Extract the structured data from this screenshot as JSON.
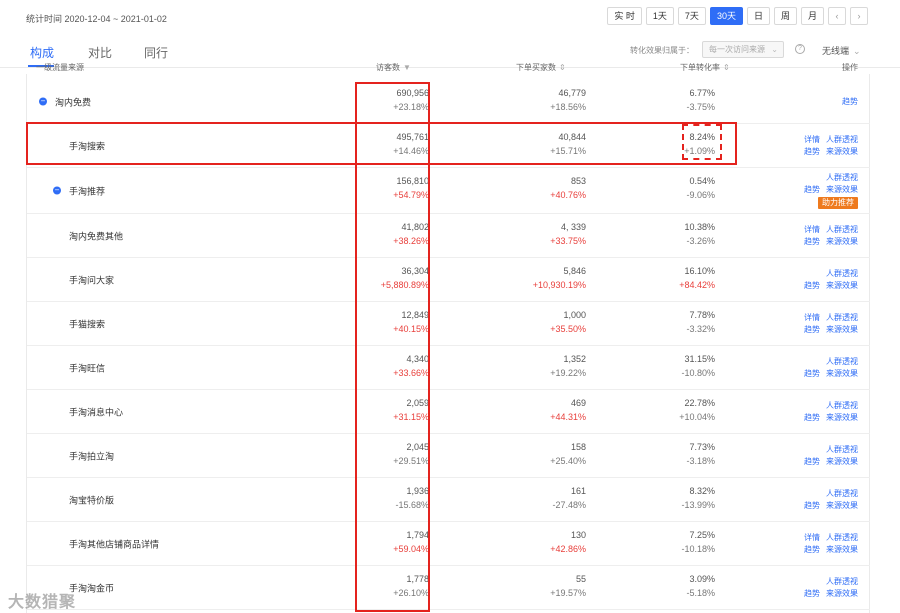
{
  "header": {
    "stat_range": "统计时间 2020-12-04 ~ 2021-01-02",
    "periods": [
      "实 时",
      "1天",
      "7天",
      "30天",
      "日",
      "周",
      "月"
    ],
    "active_period": "30天",
    "prev_arrow": "‹",
    "next_arrow": "›"
  },
  "tabs": [
    "构成",
    "对比",
    "同行"
  ],
  "active_tab": "构成",
  "attribution": {
    "label": "转化效果归属于：",
    "select_value": "每一次访问来源",
    "chevron": "⌄",
    "help": "?",
    "mode_value": "无线端",
    "mode_chevron": "⌄"
  },
  "columns": {
    "source": "一级流量来源",
    "visitors": "访客数",
    "visitors_sort": "▼",
    "buyers": "下单买家数",
    "buyers_sort": "⇕",
    "conversion": "下单转化率",
    "conversion_sort": "⇕",
    "ops": "操作"
  },
  "colors": {
    "accent": "#2f6df6",
    "increase": "#e8403c",
    "highlight": "#e4231e",
    "badge": "#ee7a1e"
  },
  "rows": [
    {
      "name": "淘内免费",
      "collapsible": true,
      "visitors": "690,956",
      "visitors_chg": "+23.18%",
      "visitors_up": false,
      "buyers": "46,779",
      "buyers_chg": "+18.56%",
      "buyers_up": false,
      "conv": "6.77%",
      "conv_chg": "-3.75%",
      "conv_up": false,
      "ops": [
        [
          "趋势"
        ]
      ]
    },
    {
      "name": "手淘搜索",
      "visitors": "495,761",
      "visitors_chg": "+14.46%",
      "visitors_up": false,
      "buyers": "40,844",
      "buyers_chg": "+15.71%",
      "buyers_up": false,
      "conv": "8.24%",
      "conv_chg": "+1.09%",
      "conv_up": false,
      "ops": [
        [
          "详情",
          "人群透视"
        ],
        [
          "趋势",
          "来源效果"
        ]
      ]
    },
    {
      "name": "手淘推荐",
      "collapsible": true,
      "visitors": "156,810",
      "visitors_chg": "+54.79%",
      "visitors_up": true,
      "buyers": "853",
      "buyers_chg": "+40.76%",
      "buyers_up": true,
      "conv": "0.54%",
      "conv_chg": "-9.06%",
      "conv_up": false,
      "ops": [
        [
          "人群透视"
        ],
        [
          "趋势",
          "来源效果"
        ]
      ],
      "badge": "助力推荐"
    },
    {
      "name": "淘内免费其他",
      "visitors": "41,802",
      "visitors_chg": "+38.26%",
      "visitors_up": true,
      "buyers": "4, 339",
      "buyers_chg": "+33.75%",
      "buyers_up": true,
      "conv": "10.38%",
      "conv_chg": "-3.26%",
      "conv_up": false,
      "ops": [
        [
          "详情",
          "人群透视"
        ],
        [
          "趋势",
          "来源效果"
        ]
      ]
    },
    {
      "name": "手淘问大家",
      "visitors": "36,304",
      "visitors_chg": "+5,880.89%",
      "visitors_up": true,
      "buyers": "5,846",
      "buyers_chg": "+10,930.19%",
      "buyers_up": true,
      "conv": "16.10%",
      "conv_chg": "+84.42%",
      "conv_up": true,
      "ops": [
        [
          "人群透视"
        ],
        [
          "趋势",
          "来源效果"
        ]
      ]
    },
    {
      "name": "手猫搜索",
      "visitors": "12,849",
      "visitors_chg": "+40.15%",
      "visitors_up": true,
      "buyers": "1,000",
      "buyers_chg": "+35.50%",
      "buyers_up": true,
      "conv": "7.78%",
      "conv_chg": "-3.32%",
      "conv_up": false,
      "ops": [
        [
          "详情",
          "人群透视"
        ],
        [
          "趋势",
          "来源效果"
        ]
      ]
    },
    {
      "name": "手淘旺信",
      "visitors": "4,340",
      "visitors_chg": "+33.66%",
      "visitors_up": true,
      "buyers": "1,352",
      "buyers_chg": "+19.22%",
      "buyers_up": false,
      "conv": "31.15%",
      "conv_chg": "-10.80%",
      "conv_up": false,
      "ops": [
        [
          "人群透视"
        ],
        [
          "趋势",
          "来源效果"
        ]
      ]
    },
    {
      "name": "手淘消息中心",
      "visitors": "2,059",
      "visitors_chg": "+31.15%",
      "visitors_up": true,
      "buyers": "469",
      "buyers_chg": "+44.31%",
      "buyers_up": true,
      "conv": "22.78%",
      "conv_chg": "+10.04%",
      "conv_up": false,
      "ops": [
        [
          "人群透视"
        ],
        [
          "趋势",
          "来源效果"
        ]
      ]
    },
    {
      "name": "手淘拍立淘",
      "visitors": "2,045",
      "visitors_chg": "+29.51%",
      "visitors_up": false,
      "buyers": "158",
      "buyers_chg": "+25.40%",
      "buyers_up": false,
      "conv": "7.73%",
      "conv_chg": "-3.18%",
      "conv_up": false,
      "ops": [
        [
          "人群透视"
        ],
        [
          "趋势",
          "来源效果"
        ]
      ]
    },
    {
      "name": "淘宝特价版",
      "visitors": "1,936",
      "visitors_chg": "-15.68%",
      "visitors_up": false,
      "buyers": "161",
      "buyers_chg": "-27.48%",
      "buyers_up": false,
      "conv": "8.32%",
      "conv_chg": "-13.99%",
      "conv_up": false,
      "ops": [
        [
          "人群透视"
        ],
        [
          "趋势",
          "来源效果"
        ]
      ]
    },
    {
      "name": "手淘其他店铺商品详情",
      "visitors": "1,794",
      "visitors_chg": "+59.04%",
      "visitors_up": true,
      "buyers": "130",
      "buyers_chg": "+42.86%",
      "buyers_up": true,
      "conv": "7.25%",
      "conv_chg": "-10.18%",
      "conv_up": false,
      "ops": [
        [
          "详情",
          "人群透视"
        ],
        [
          "趋势",
          "来源效果"
        ]
      ]
    },
    {
      "name": "手淘淘金币",
      "visitors": "1,778",
      "visitors_chg": "+26.10%",
      "visitors_up": false,
      "buyers": "55",
      "buyers_chg": "+19.57%",
      "buyers_up": false,
      "conv": "3.09%",
      "conv_chg": "-5.18%",
      "conv_up": false,
      "ops": [
        [
          "人群透视"
        ],
        [
          "趋势",
          "来源效果"
        ]
      ]
    }
  ],
  "watermark": "大数猎聚"
}
